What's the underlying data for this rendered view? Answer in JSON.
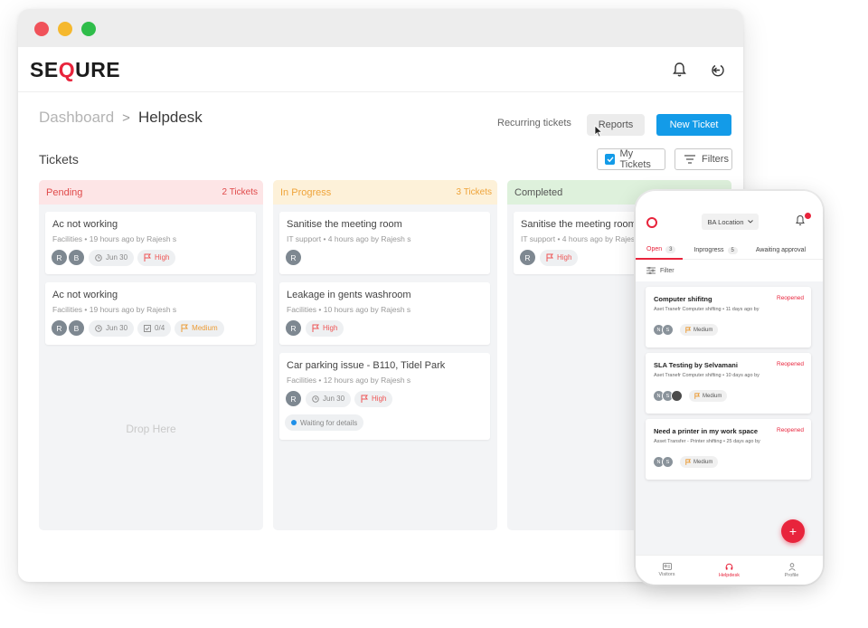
{
  "window": {
    "logo": {
      "prefix": "SE",
      "q": "Q",
      "suffix": "URE"
    },
    "icons": {
      "bell": "bell-icon",
      "logout": "logout-icon"
    }
  },
  "breadcrumb": {
    "parent": "Dashboard",
    "separator": ">",
    "current": "Helpdesk"
  },
  "toolbar": {
    "recurring": "Recurring tickets",
    "reports": "Reports",
    "new_ticket": "New Ticket",
    "my_tickets": "My Tickets",
    "filters": "Filters"
  },
  "section_title": "Tickets",
  "colors": {
    "accent": "#139be8",
    "brand": "#e8243c",
    "pending": "#e04a4a",
    "in_progress": "#efa43a",
    "completed_bg": "#def1dc"
  },
  "columns": {
    "pending": {
      "title": "Pending",
      "count": "2 Tickets",
      "drop_hint": "Drop Here",
      "cards": [
        {
          "title": "Ac not working",
          "meta": "Facilities • 19 hours ago by Rajesh s",
          "avatars": [
            "R",
            "B"
          ],
          "date": "Jun 30",
          "priority": "High"
        },
        {
          "title": "Ac not working",
          "meta": "Facilities • 19 hours ago by Rajesh s",
          "avatars": [
            "R",
            "B"
          ],
          "date": "Jun 30",
          "checklist": "0/4",
          "priority": "Medium"
        }
      ]
    },
    "in_progress": {
      "title": "In Progress",
      "count": "3 Tickets",
      "cards": [
        {
          "title": "Sanitise the meeting room",
          "meta": "IT support • 4 hours ago by Rajesh s",
          "avatars": [
            "R"
          ]
        },
        {
          "title": "Leakage in gents washroom",
          "meta": "Facilities • 10 hours ago by Rajesh s",
          "avatars": [
            "R"
          ],
          "priority": "High"
        },
        {
          "title": "Car parking issue - B110, Tidel Park",
          "meta": "Facilities • 12 hours ago by Rajesh s",
          "avatars": [
            "R"
          ],
          "date": "Jun 30",
          "priority": "High",
          "status": "Waiting for details"
        }
      ]
    },
    "completed": {
      "title": "Completed",
      "cards": [
        {
          "title": "Sanitise the meeting room",
          "meta": "IT support • 4 hours ago by Rajesh s",
          "avatars": [
            "R"
          ],
          "priority": "High"
        }
      ]
    }
  },
  "phone": {
    "location": "BA Location",
    "tabs": [
      {
        "label": "Open",
        "count": "3"
      },
      {
        "label": "Inprogress",
        "count": "5"
      },
      {
        "label": "Awaiting approval",
        "count": ""
      }
    ],
    "filter": "Filter",
    "cards": [
      {
        "title": "Computer shifitng",
        "meta": "Aset Tranefr Computer shifting • 11 days ago by",
        "status": "Reopened",
        "avatars": [
          "N",
          "S"
        ],
        "priority": "Medium"
      },
      {
        "title": "SLA Testing by Selvamani",
        "meta": "Aset Tranefr Computer shifting • 10 days ago by",
        "status": "Reopened",
        "avatars": [
          "N",
          "S",
          ""
        ],
        "priority": "Medium"
      },
      {
        "title": "Need a printer in my work space",
        "meta": "Asset Transfer - Printer shifting • 25 days ago by",
        "status": "Reopened",
        "avatars": [
          "N",
          "S"
        ],
        "priority": "Medium"
      }
    ],
    "fab": "+",
    "nav": [
      {
        "label": "Visitors"
      },
      {
        "label": "Helpdesk"
      },
      {
        "label": "Profile"
      }
    ]
  }
}
